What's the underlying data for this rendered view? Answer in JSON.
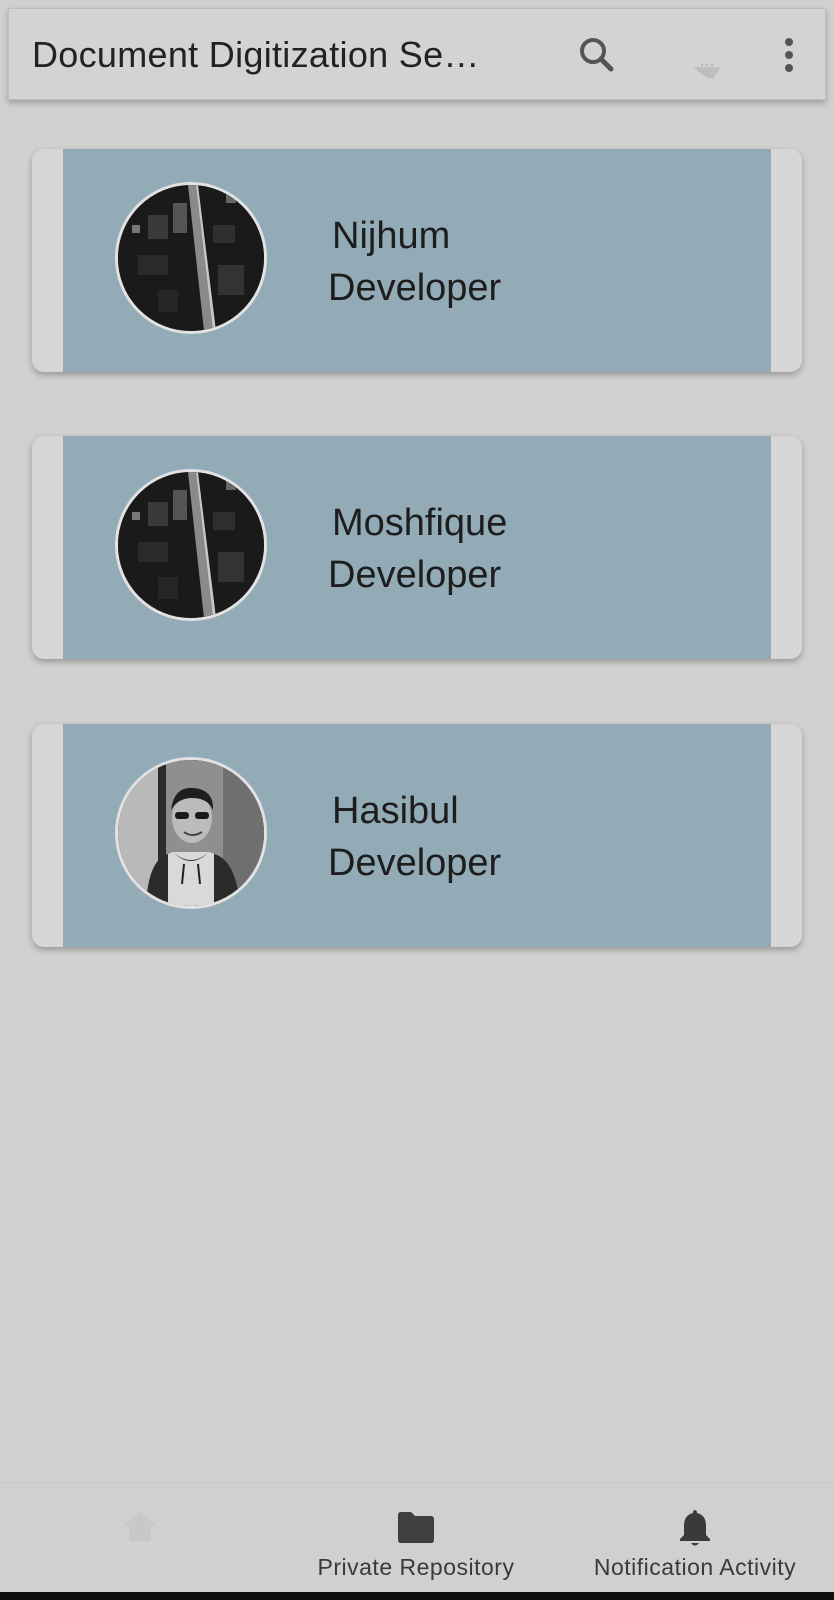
{
  "app_bar": {
    "title": "Document Digitization Se…",
    "icons": [
      "search-icon",
      "sort-icon",
      "more-vert-icon"
    ]
  },
  "members": [
    {
      "name": "Nijhum",
      "role": "Developer",
      "avatar": "city-aerial-photo"
    },
    {
      "name": "Moshfique",
      "role": "Developer",
      "avatar": "city-aerial-photo"
    },
    {
      "name": "Hasibul",
      "role": "Developer",
      "avatar": "person-photo"
    }
  ],
  "bottom_nav": {
    "items": [
      {
        "label": "",
        "icon": "home-icon"
      },
      {
        "label": "Private Repository",
        "icon": "folder-icon"
      },
      {
        "label": "Notification Activity",
        "icon": "bell-icon"
      }
    ]
  },
  "colors": {
    "background": "#d1d1d1",
    "card_accent": "#93abb7",
    "text": "#1d1d1d"
  }
}
